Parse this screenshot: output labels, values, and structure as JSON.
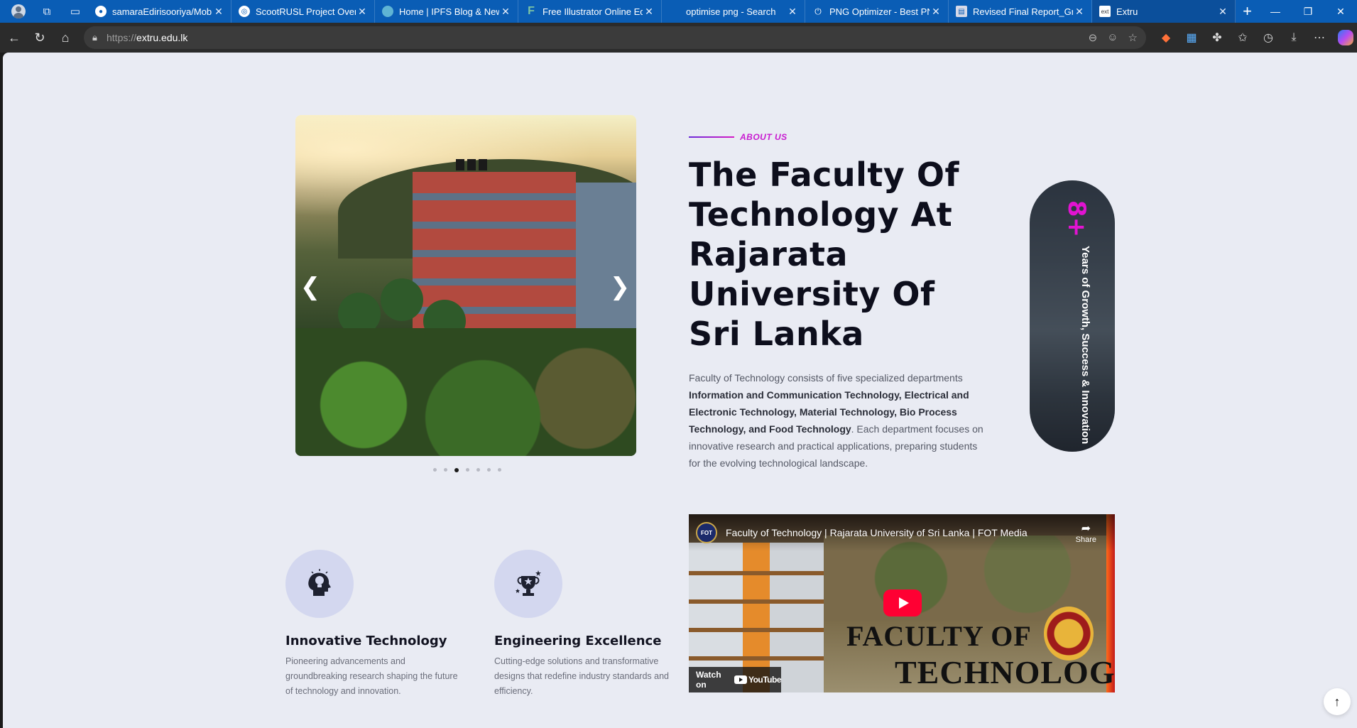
{
  "browser": {
    "tabs": [
      {
        "title": "samaraEdirisooriya/Mobil",
        "favicon": "github-icon"
      },
      {
        "title": "ScootRUSL Project Overvi",
        "favicon": "openai-icon"
      },
      {
        "title": "Home | IPFS Blog & News",
        "favicon": "ipfs-icon"
      },
      {
        "title": "Free Illustrator Online Edi",
        "favicon": "f-icon"
      },
      {
        "title": "optimise png - Search",
        "favicon": "search-icon"
      },
      {
        "title": "PNG Optimizer - Best PNG",
        "favicon": "png-icon"
      },
      {
        "title": "Revised Final Report_Grou",
        "favicon": "doc-icon"
      },
      {
        "title": "Extru",
        "favicon": "extru-icon",
        "active": true
      }
    ],
    "address": {
      "scheme": "https://",
      "host": "extru.edu.lk"
    }
  },
  "about": {
    "label": "About Us",
    "heading": "The Faculty Of Technology At Rajarata University Of Sri Lanka",
    "desc_intro": "Faculty of Technology consists of five specialized departments ",
    "desc_bold": "Information and Communication Technology, Electrical and Electronic Technology, Material Technology, Bio Process Technology, and Food Technology",
    "desc_outro": ". Each department focuses on innovative research and practical applications, preparing students for the evolving technological landscape."
  },
  "slider": {
    "dot_count": 7,
    "active_index": 2
  },
  "stat": {
    "number": "8+",
    "caption": "Years of Growth, Success & Innovation"
  },
  "features": [
    {
      "title": "Innovative Technology",
      "text": "Pioneering advancements and groundbreaking research shaping the future of technology and innovation.",
      "icon": "head-lightbulb-icon"
    },
    {
      "title": "Engineering Excellence",
      "text": "Cutting-edge solutions and transformative designs that redefine industry standards and efficiency.",
      "icon": "trophy-star-icon"
    }
  ],
  "video": {
    "title": "Faculty of Technology | Rajarata University of Sri Lanka | FOT Media",
    "channel_badge": "FOT",
    "share_label": "Share",
    "watch_on": "Watch on",
    "youtube_label": "YouTube",
    "overlay_line1": "FACULTY OF",
    "overlay_line2": "TECHNOLOGY"
  },
  "colors": {
    "accent": "#c81ad0",
    "page_bg": "#e9ebf3",
    "heading": "#0d0e1c"
  }
}
